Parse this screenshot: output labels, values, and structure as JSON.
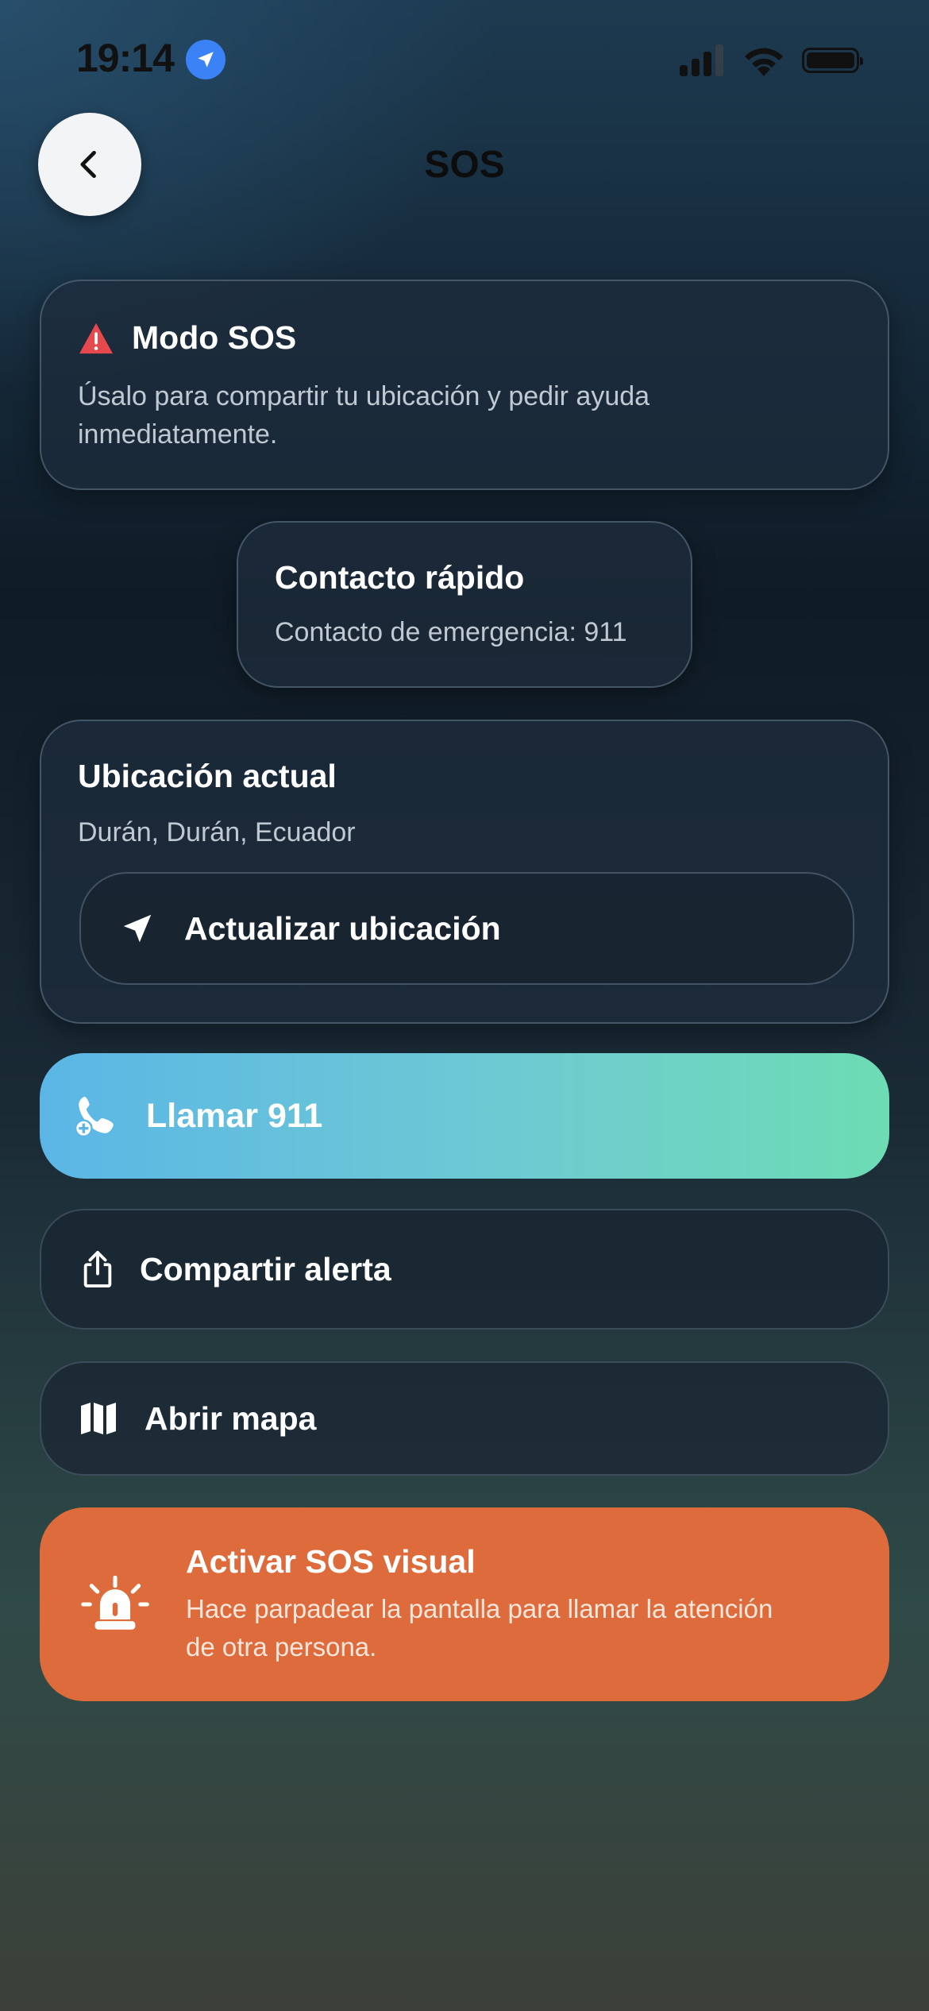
{
  "status_bar": {
    "time": "19:14"
  },
  "header": {
    "title": "SOS"
  },
  "sos_card": {
    "title": "Modo SOS",
    "description": "Úsalo para compartir tu ubicación y pedir ayuda inmediatamente.",
    "icon": "warning-icon",
    "icon_color": "#e5484d"
  },
  "contact_card": {
    "title": "Contacto rápido",
    "subtitle": "Contacto de emergencia: 911"
  },
  "location_card": {
    "title": "Ubicación actual",
    "location": "Durán, Durán, Ecuador",
    "update_label": "Actualizar ubicación"
  },
  "actions": {
    "call_label": "Llamar 911",
    "share_label": "Compartir alerta",
    "map_label": "Abrir mapa"
  },
  "visual_sos": {
    "title": "Activar SOS visual",
    "description": "Hace parpadear la pantalla para llamar la atención de otra persona.",
    "color": "#dd6b3b"
  }
}
